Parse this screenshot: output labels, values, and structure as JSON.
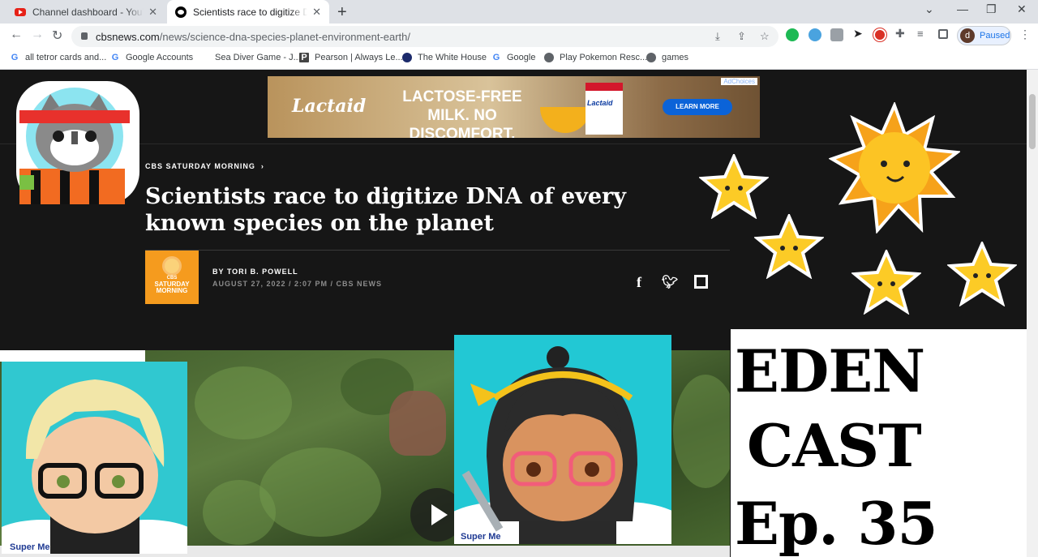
{
  "browser": {
    "tabs": [
      {
        "title": "Channel dashboard - YouTube Studio",
        "icon": "youtube-icon"
      },
      {
        "title": "Scientists race to digitize DNA of every known species",
        "icon": "cbs-icon",
        "active": true
      }
    ],
    "url_host": "cbsnews.com",
    "url_path": "/news/science-dna-species-planet-environment-earth/",
    "profile": {
      "initial": "d",
      "status": "Paused"
    },
    "bookmarks": [
      {
        "label": "all tetror cards and...",
        "icon": "google-icon"
      },
      {
        "label": "Google Accounts",
        "icon": "google-icon"
      },
      {
        "label": "Sea Diver Game - J...",
        "icon": "blank-icon"
      },
      {
        "label": "Pearson | Always Le...",
        "icon": "pearson-icon"
      },
      {
        "label": "The White House",
        "icon": "whitehouse-icon"
      },
      {
        "label": "Google",
        "icon": "google-icon"
      },
      {
        "label": "Play Pokemon Resc...",
        "icon": "globe-icon"
      },
      {
        "label": "games",
        "icon": "globe-icon"
      }
    ]
  },
  "ad": {
    "brand": "Lactaid",
    "headline": "LACTOSE-FREE MILK. NO DISCOMFORT.",
    "carton_label": "Lactaid",
    "cta": "LEARN MORE",
    "choices": "AdChoices"
  },
  "article": {
    "kicker": "CBS SATURDAY MORNING",
    "title": "Scientists race to digitize DNA of every known species on the planet",
    "author": "BY TORI B. POWELL",
    "dateline": "AUGUST 27, 2022 / 2:07 PM / CBS NEWS",
    "logo_text": "SATURDAY MORNING",
    "logo_small": "CBS"
  },
  "overlay": {
    "eden_lines": [
      "EDEN",
      "CAST",
      "Ep. 35"
    ],
    "watermark": "Super Me"
  },
  "colors": {
    "page_bg": "#161616",
    "cbs_orange": "#f59b1e",
    "ad_button": "#0b63d8"
  }
}
